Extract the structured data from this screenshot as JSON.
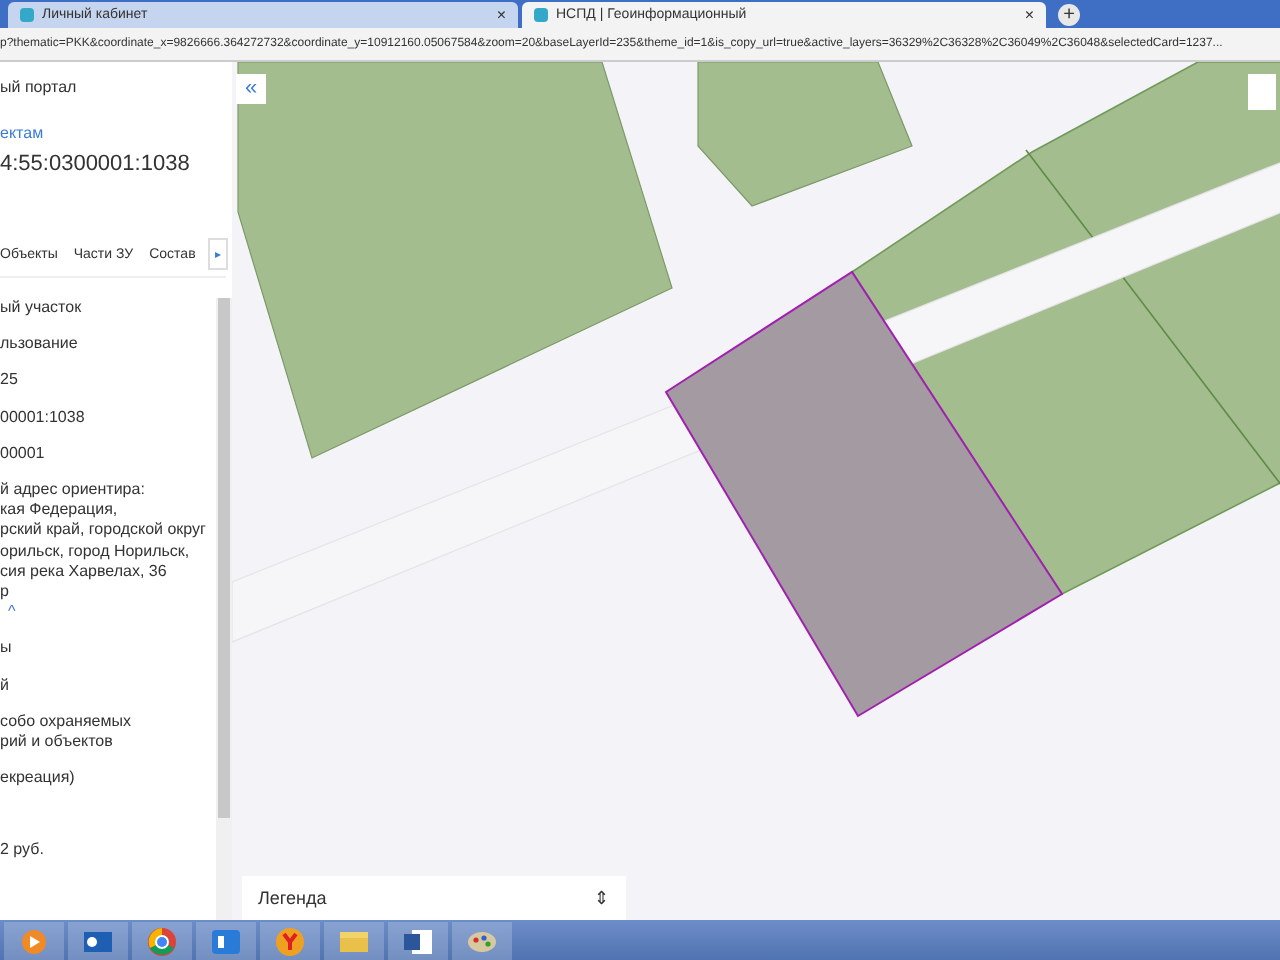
{
  "browser": {
    "tabs": [
      {
        "title": "Личный кабинет",
        "selected": false,
        "close": "×"
      },
      {
        "title": "НСПД | Геоинформационный",
        "selected": true,
        "close": "×"
      }
    ],
    "new_tab": "+",
    "address": "p?thematic=PKK&coordinate_x=9826666.364272732&coordinate_y=10912160.05067584&zoom=20&baseLayerId=235&theme_id=1&is_copy_url=true&active_layers=36329%2C36328%2C36049%2C36048&selectedCard=1237..."
  },
  "sidebar": {
    "portal": "ый портал",
    "link": "ектам",
    "cadastral_number": "4:55:0300001:1038",
    "tabs": [
      {
        "label": "Объекты"
      },
      {
        "label": "Части ЗУ"
      },
      {
        "label": "Состав"
      }
    ],
    "tabs_next": "▸",
    "sections": [
      {
        "lines": [
          {
            "kind": "text",
            "text": "ый участок"
          }
        ]
      },
      {
        "lines": [
          {
            "kind": "text",
            "text": "льзование"
          }
        ]
      },
      {
        "lines": [
          {
            "kind": "text",
            "text": "25"
          }
        ]
      },
      {
        "lines": [
          {
            "kind": "text",
            "text": "00001:1038"
          }
        ]
      },
      {
        "lines": [
          {
            "kind": "text",
            "text": "00001"
          }
        ]
      },
      {
        "lines": [
          {
            "kind": "text",
            "text": "й адрес ориентира:"
          },
          {
            "kind": "text",
            "text": "кая Федерация,"
          },
          {
            "kind": "text",
            "text": "рский край, городской округ"
          },
          {
            "kind": "text",
            "text": "орильск, город Норильск,"
          },
          {
            "kind": "text",
            "text": "сия река Харвелах, 36"
          },
          {
            "kind": "text",
            "text": "р"
          },
          {
            "kind": "toggle",
            "text": "^"
          }
        ]
      },
      {
        "lines": [
          {
            "kind": "text",
            "text": "ы"
          }
        ]
      },
      {
        "lines": [
          {
            "kind": "text",
            "text": "й"
          }
        ]
      },
      {
        "lines": [
          {
            "kind": "text",
            "text": "собо охраняемых"
          },
          {
            "kind": "text",
            "text": "рий и объектов"
          }
        ]
      },
      {
        "lines": [
          {
            "kind": "text",
            "text": "екреация)"
          }
        ]
      },
      {
        "lines": [
          {
            "kind": "text",
            "text": "2 руб."
          }
        ]
      }
    ]
  },
  "map": {
    "collapse": "«",
    "legend": "Легенда",
    "legend_caret": "⇕"
  }
}
